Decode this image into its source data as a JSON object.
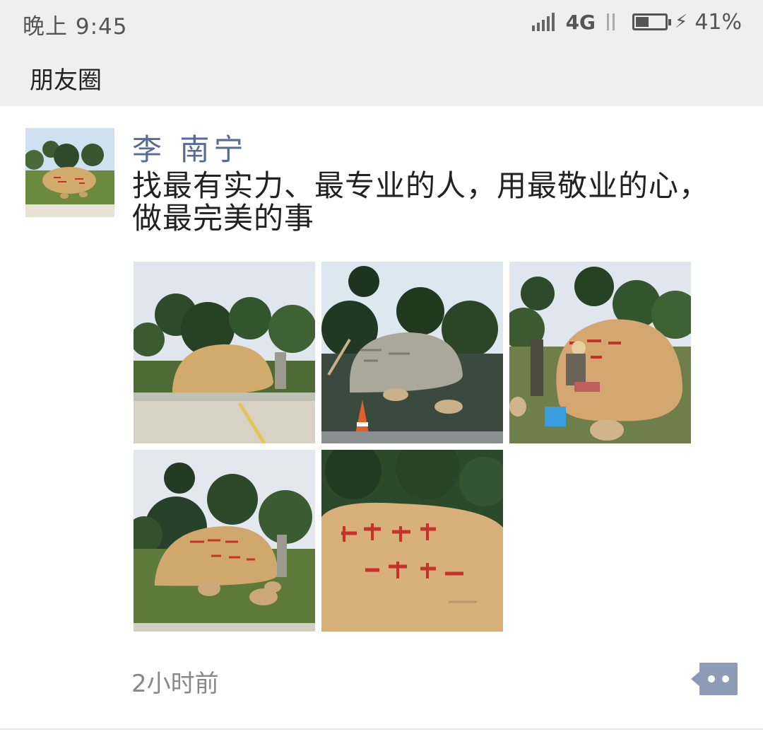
{
  "status_bar": {
    "time": "晚上 9:45",
    "network": "4G",
    "battery_percent": "41%",
    "battery_level": 0.41,
    "icons": [
      "signal-icon",
      "data-transfer-icon",
      "battery-icon",
      "charging-icon"
    ]
  },
  "header": {
    "title": "朋友圈"
  },
  "post": {
    "author": "李 南宁",
    "text": "找最有实力、最专业的人，用最敬业的心，做最完美的事",
    "timestamp": "2小时前",
    "photo_count": 5
  },
  "colors": {
    "status_bg": "#efefef",
    "author_name": "#576b95",
    "timestamp": "#888888",
    "more_button": "#8e9bb6",
    "stone": "#d2aa6c",
    "inscription": "#c8302a"
  }
}
